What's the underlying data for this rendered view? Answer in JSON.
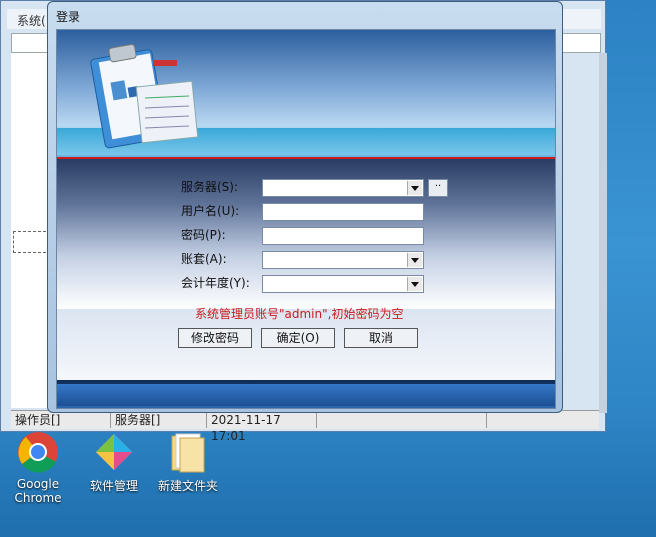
{
  "background_window": {
    "menu_title": "系统(",
    "status_operator": "操作员[]",
    "status_server": "服务器[]",
    "status_datetime": "2021-11-17  17:01"
  },
  "dialog": {
    "title": "登录",
    "fields": {
      "server_label": "服务器(S):",
      "user_label": "用户名(U):",
      "password_label": "密码(P):",
      "account_set_label": "账套(A):",
      "fiscal_year_label": "会计年度(Y):",
      "server_value": "",
      "user_value": "",
      "password_value": "",
      "account_set_value": "",
      "fiscal_year_value": ""
    },
    "browse_label": "··",
    "hint": "系统管理员账号\"admin\",初始密码为空",
    "buttons": {
      "change_password": "修改密码",
      "ok": "确定(O)",
      "cancel": "取消"
    }
  },
  "desktop": {
    "icons": [
      {
        "label": "Google Chrome"
      },
      {
        "label": "软件管理"
      },
      {
        "label": "新建文件夹"
      }
    ]
  },
  "colors": {
    "hint_red": "#cc1b1b",
    "desktop_blue": "#2c82c4"
  }
}
